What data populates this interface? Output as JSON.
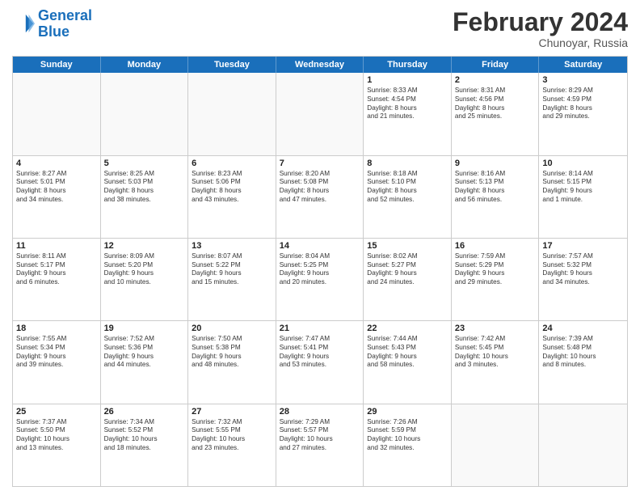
{
  "header": {
    "logo_line1": "General",
    "logo_line2": "Blue",
    "title": "February 2024",
    "subtitle": "Chunoyar, Russia"
  },
  "days_of_week": [
    "Sunday",
    "Monday",
    "Tuesday",
    "Wednesday",
    "Thursday",
    "Friday",
    "Saturday"
  ],
  "rows": [
    [
      {
        "day": "",
        "lines": []
      },
      {
        "day": "",
        "lines": []
      },
      {
        "day": "",
        "lines": []
      },
      {
        "day": "",
        "lines": []
      },
      {
        "day": "1",
        "lines": [
          "Sunrise: 8:33 AM",
          "Sunset: 4:54 PM",
          "Daylight: 8 hours",
          "and 21 minutes."
        ]
      },
      {
        "day": "2",
        "lines": [
          "Sunrise: 8:31 AM",
          "Sunset: 4:56 PM",
          "Daylight: 8 hours",
          "and 25 minutes."
        ]
      },
      {
        "day": "3",
        "lines": [
          "Sunrise: 8:29 AM",
          "Sunset: 4:59 PM",
          "Daylight: 8 hours",
          "and 29 minutes."
        ]
      }
    ],
    [
      {
        "day": "4",
        "lines": [
          "Sunrise: 8:27 AM",
          "Sunset: 5:01 PM",
          "Daylight: 8 hours",
          "and 34 minutes."
        ]
      },
      {
        "day": "5",
        "lines": [
          "Sunrise: 8:25 AM",
          "Sunset: 5:03 PM",
          "Daylight: 8 hours",
          "and 38 minutes."
        ]
      },
      {
        "day": "6",
        "lines": [
          "Sunrise: 8:23 AM",
          "Sunset: 5:06 PM",
          "Daylight: 8 hours",
          "and 43 minutes."
        ]
      },
      {
        "day": "7",
        "lines": [
          "Sunrise: 8:20 AM",
          "Sunset: 5:08 PM",
          "Daylight: 8 hours",
          "and 47 minutes."
        ]
      },
      {
        "day": "8",
        "lines": [
          "Sunrise: 8:18 AM",
          "Sunset: 5:10 PM",
          "Daylight: 8 hours",
          "and 52 minutes."
        ]
      },
      {
        "day": "9",
        "lines": [
          "Sunrise: 8:16 AM",
          "Sunset: 5:13 PM",
          "Daylight: 8 hours",
          "and 56 minutes."
        ]
      },
      {
        "day": "10",
        "lines": [
          "Sunrise: 8:14 AM",
          "Sunset: 5:15 PM",
          "Daylight: 9 hours",
          "and 1 minute."
        ]
      }
    ],
    [
      {
        "day": "11",
        "lines": [
          "Sunrise: 8:11 AM",
          "Sunset: 5:17 PM",
          "Daylight: 9 hours",
          "and 6 minutes."
        ]
      },
      {
        "day": "12",
        "lines": [
          "Sunrise: 8:09 AM",
          "Sunset: 5:20 PM",
          "Daylight: 9 hours",
          "and 10 minutes."
        ]
      },
      {
        "day": "13",
        "lines": [
          "Sunrise: 8:07 AM",
          "Sunset: 5:22 PM",
          "Daylight: 9 hours",
          "and 15 minutes."
        ]
      },
      {
        "day": "14",
        "lines": [
          "Sunrise: 8:04 AM",
          "Sunset: 5:25 PM",
          "Daylight: 9 hours",
          "and 20 minutes."
        ]
      },
      {
        "day": "15",
        "lines": [
          "Sunrise: 8:02 AM",
          "Sunset: 5:27 PM",
          "Daylight: 9 hours",
          "and 24 minutes."
        ]
      },
      {
        "day": "16",
        "lines": [
          "Sunrise: 7:59 AM",
          "Sunset: 5:29 PM",
          "Daylight: 9 hours",
          "and 29 minutes."
        ]
      },
      {
        "day": "17",
        "lines": [
          "Sunrise: 7:57 AM",
          "Sunset: 5:32 PM",
          "Daylight: 9 hours",
          "and 34 minutes."
        ]
      }
    ],
    [
      {
        "day": "18",
        "lines": [
          "Sunrise: 7:55 AM",
          "Sunset: 5:34 PM",
          "Daylight: 9 hours",
          "and 39 minutes."
        ]
      },
      {
        "day": "19",
        "lines": [
          "Sunrise: 7:52 AM",
          "Sunset: 5:36 PM",
          "Daylight: 9 hours",
          "and 44 minutes."
        ]
      },
      {
        "day": "20",
        "lines": [
          "Sunrise: 7:50 AM",
          "Sunset: 5:38 PM",
          "Daylight: 9 hours",
          "and 48 minutes."
        ]
      },
      {
        "day": "21",
        "lines": [
          "Sunrise: 7:47 AM",
          "Sunset: 5:41 PM",
          "Daylight: 9 hours",
          "and 53 minutes."
        ]
      },
      {
        "day": "22",
        "lines": [
          "Sunrise: 7:44 AM",
          "Sunset: 5:43 PM",
          "Daylight: 9 hours",
          "and 58 minutes."
        ]
      },
      {
        "day": "23",
        "lines": [
          "Sunrise: 7:42 AM",
          "Sunset: 5:45 PM",
          "Daylight: 10 hours",
          "and 3 minutes."
        ]
      },
      {
        "day": "24",
        "lines": [
          "Sunrise: 7:39 AM",
          "Sunset: 5:48 PM",
          "Daylight: 10 hours",
          "and 8 minutes."
        ]
      }
    ],
    [
      {
        "day": "25",
        "lines": [
          "Sunrise: 7:37 AM",
          "Sunset: 5:50 PM",
          "Daylight: 10 hours",
          "and 13 minutes."
        ]
      },
      {
        "day": "26",
        "lines": [
          "Sunrise: 7:34 AM",
          "Sunset: 5:52 PM",
          "Daylight: 10 hours",
          "and 18 minutes."
        ]
      },
      {
        "day": "27",
        "lines": [
          "Sunrise: 7:32 AM",
          "Sunset: 5:55 PM",
          "Daylight: 10 hours",
          "and 23 minutes."
        ]
      },
      {
        "day": "28",
        "lines": [
          "Sunrise: 7:29 AM",
          "Sunset: 5:57 PM",
          "Daylight: 10 hours",
          "and 27 minutes."
        ]
      },
      {
        "day": "29",
        "lines": [
          "Sunrise: 7:26 AM",
          "Sunset: 5:59 PM",
          "Daylight: 10 hours",
          "and 32 minutes."
        ]
      },
      {
        "day": "",
        "lines": []
      },
      {
        "day": "",
        "lines": []
      }
    ]
  ]
}
